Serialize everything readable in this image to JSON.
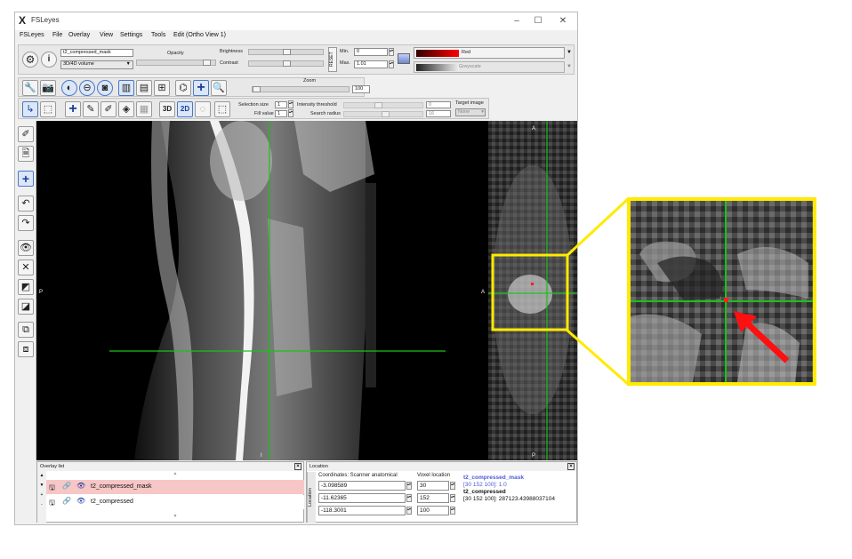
{
  "window": {
    "title": "FSLeyes",
    "controls": {
      "minimize": "–",
      "maximize": "☐",
      "close": "✕"
    }
  },
  "menubar": [
    "FSLeyes",
    "File",
    "Overlay",
    "View",
    "Settings",
    "Tools",
    "Edit (Ortho View 1)"
  ],
  "overlay_toolbar": {
    "name_value": "t2_compressed_mask",
    "type_value": "3D/4D volume",
    "opacity_label": "Opacity",
    "brightness_label": "Brightness",
    "contrast_label": "Contrast",
    "reset_label": "RESET",
    "min_label": "Min.",
    "min_value": "0",
    "max_label": "Max.",
    "max_value": "1.01",
    "cmap1_label": "Red",
    "cmap2_label": "Greyscale"
  },
  "ortho_toolbar": {
    "zoom_label": "Zoom",
    "zoom_value": "100"
  },
  "edit_toolbar": {
    "mode_3d": "3D",
    "mode_2d": "2D",
    "selection_size_label": "Selection size",
    "selection_size_value": "1",
    "fill_value_label": "Fill value",
    "fill_value_value": "1",
    "intensity_threshold_label": "Intensity threshold",
    "intensity_threshold_value": "0",
    "search_radius_label": "Search radius",
    "search_radius_value": "16",
    "target_image_label": "Target image",
    "target_image_value": "None"
  },
  "canvas": {
    "label_left": "P",
    "label_right": "A",
    "label_bottom": "I",
    "label_top": "A",
    "label_bottom2": "P"
  },
  "overlay_list": {
    "title": "Overlay list",
    "items": [
      {
        "name": "t2_compressed_mask",
        "selected": true
      },
      {
        "name": "t2_compressed",
        "selected": false
      }
    ]
  },
  "location": {
    "title": "Location",
    "tab_label": "Location",
    "coords_header": "Coordinates: Scanner anatomical",
    "voxel_header": "Voxel location",
    "coords": [
      "-3.098589",
      "-11.62365",
      "-118.3001"
    ],
    "voxels": [
      "30",
      "152",
      "100"
    ],
    "info": [
      {
        "name": "t2_compressed_mask",
        "value": "[30 152 100]: 1.0",
        "color": "#4a5ad8"
      },
      {
        "name": "t2_compressed",
        "value": "[30 152 100]: 287123.43988037104",
        "color": "#111111"
      }
    ]
  },
  "colors": {
    "crosshair": "#19c219",
    "highlight": "#ffea00",
    "arrow": "#ff1010",
    "selected_row": "#f7c6c6",
    "red_cmap": "#cc0000"
  }
}
